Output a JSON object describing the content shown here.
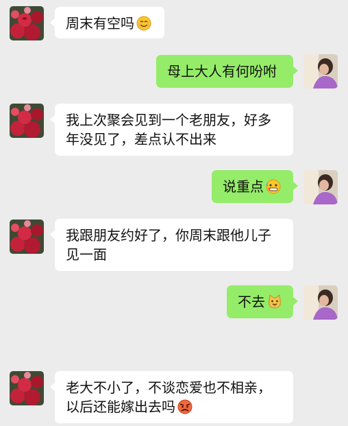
{
  "messages": [
    {
      "side": "in",
      "text": "周末有空吗",
      "emoji": "smile-emoji"
    },
    {
      "side": "out",
      "text": "母上大人有何吩咐",
      "emoji": null
    },
    {
      "side": "in",
      "line1": "我上次聚会见到一个老朋友，好多",
      "line2": "年没见了，差点认不出来"
    },
    {
      "side": "out",
      "text": "说重点",
      "emoji": "sweat-emoji"
    },
    {
      "side": "in",
      "line1": "我跟朋友约好了，你周末跟他儿子",
      "line2": "见一面"
    },
    {
      "side": "out",
      "text": "不去",
      "emoji": "cat-emoji"
    },
    {
      "side": "in",
      "line1": "老大不小了，不谈恋爱也不相亲，",
      "line2": "以后还能嫁出去吗",
      "emoji": "angry-emoji"
    }
  ],
  "colors": {
    "background": "#ececec",
    "incoming_bubble": "#ffffff",
    "outgoing_bubble": "#95ec69"
  }
}
